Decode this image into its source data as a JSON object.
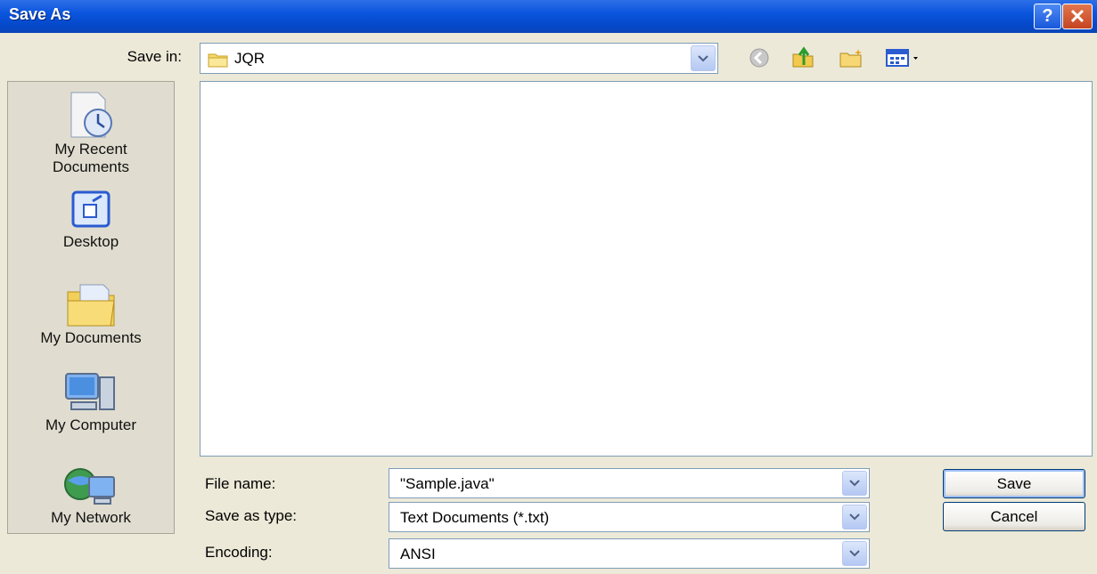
{
  "window": {
    "title": "Save As"
  },
  "titlebar": {
    "help_glyph": "?",
    "close_glyph": "✕"
  },
  "save_in": {
    "label": "Save in:",
    "value": "JQR",
    "icon": "folder-icon"
  },
  "toolbar": {
    "icons": [
      "back-icon",
      "up-folder-icon",
      "new-folder-icon",
      "view-menu-icon"
    ]
  },
  "places": [
    {
      "label_lines": [
        "My Recent",
        "Documents"
      ],
      "icon": "recent-documents-icon"
    },
    {
      "label_lines": [
        "Desktop"
      ],
      "icon": "desktop-icon"
    },
    {
      "label_lines": [
        "My Documents"
      ],
      "icon": "my-documents-icon"
    },
    {
      "label_lines": [
        "My Computer"
      ],
      "icon": "my-computer-icon"
    },
    {
      "label_lines": [
        "My Network"
      ],
      "icon": "my-network-icon"
    }
  ],
  "form": {
    "file_name": {
      "label": "File name:",
      "value": "\"Sample.java\""
    },
    "save_as_type": {
      "label": "Save as type:",
      "value": "Text Documents (*.txt)"
    },
    "encoding": {
      "label": "Encoding:",
      "value": "ANSI"
    }
  },
  "buttons": {
    "save": "Save",
    "cancel": "Cancel"
  },
  "colors": {
    "titlebar": "#0a55de",
    "dialog_bg": "#ece9d8",
    "border": "#7f9db9"
  }
}
